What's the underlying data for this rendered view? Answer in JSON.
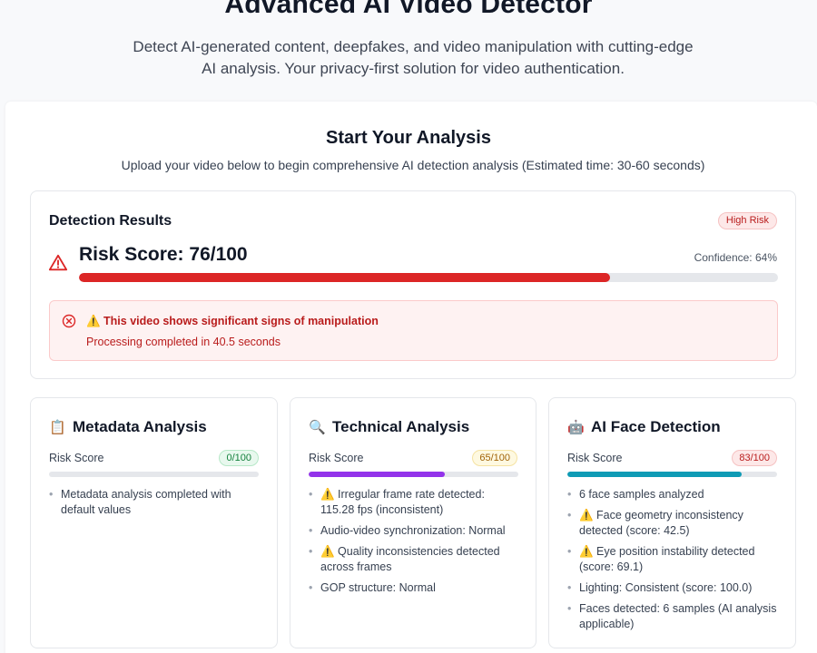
{
  "hero": {
    "title": "Advanced AI Video Detector",
    "subtitle": "Detect AI-generated content, deepfakes, and video manipulation with cutting-edge AI analysis. Your privacy-first solution for video authentication."
  },
  "start": {
    "title": "Start Your Analysis",
    "subtitle": "Upload your video below to begin comprehensive AI detection analysis (Estimated time: 30-60 seconds)"
  },
  "results": {
    "title": "Detection Results",
    "badge": "High Risk",
    "score_text": "Risk Score: 76/100",
    "score_value": 76,
    "confidence": "Confidence: 64%",
    "alert_line1": "⚠️ This video shows significant signs of manipulation",
    "alert_line2": "Processing completed in 40.5 seconds",
    "colors": {
      "bar": "#dc2626",
      "alert_text": "#b91c1c"
    }
  },
  "cards": [
    {
      "icon": "clipboard-icon",
      "glyph": "📋",
      "title": "Metadata Analysis",
      "risk_label": "Risk Score",
      "badge": "0/100",
      "value": 0,
      "color": "#22c55e",
      "items": [
        "Metadata analysis completed with default values"
      ]
    },
    {
      "icon": "magnifier-icon",
      "glyph": "🔍",
      "title": "Technical Analysis",
      "risk_label": "Risk Score",
      "badge": "65/100",
      "value": 65,
      "color": "#9333ea",
      "items": [
        "⚠️ Irregular frame rate detected: 115.28 fps (inconsistent)",
        "Audio-video synchronization: Normal",
        "⚠️ Quality inconsistencies detected across frames",
        "GOP structure: Normal"
      ]
    },
    {
      "icon": "robot-icon",
      "glyph": "🤖",
      "title": "AI Face Detection",
      "risk_label": "Risk Score",
      "badge": "83/100",
      "value": 83,
      "color": "#0e9bb5",
      "items": [
        "6 face samples analyzed",
        "⚠️ Face geometry inconsistency detected (score: 42.5)",
        "⚠️ Eye position instability detected (score: 69.1)",
        "Lighting: Consistent (score: 100.0)",
        "Faces detected: 6 samples (AI analysis applicable)"
      ]
    }
  ]
}
